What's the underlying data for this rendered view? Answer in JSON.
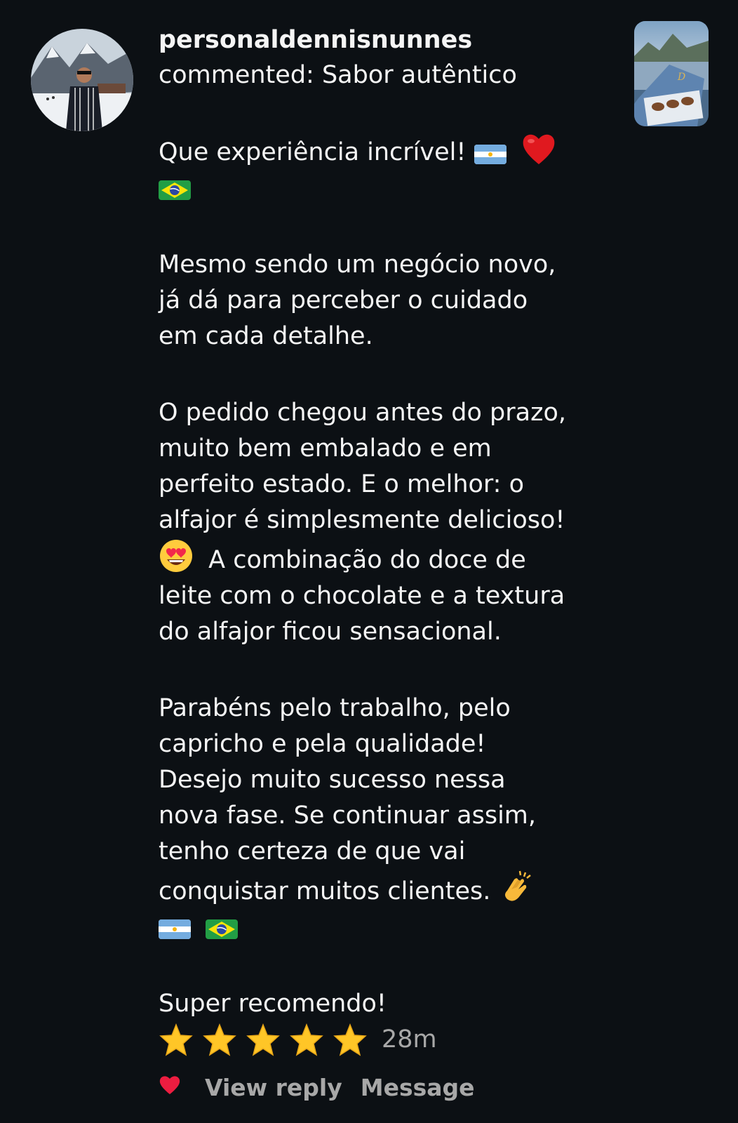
{
  "comment": {
    "username": "personaldennisnunnes",
    "subtitle": "commented: Sabor autêntico",
    "p1": {
      "line1": "Que experiência incrível!"
    },
    "p2": {
      "line1": "Mesmo sendo um negócio novo,",
      "line2": "já dá para perceber o cuidado",
      "line3": "em cada detalhe."
    },
    "p3": {
      "line1": "O pedido chegou antes do prazo,",
      "line2": "muito bem embalado e em",
      "line3": "perfeito estado. E o melhor: o",
      "line4": "alfajor é simplesmente delicioso!",
      "line5": "A combinação do doce de",
      "line6": "leite com o chocolate e a textura",
      "line7": "do alfajor ficou sensacional."
    },
    "p4": {
      "line1": "Parabéns pelo trabalho, pelo",
      "line2": "capricho e pela qualidade!",
      "line3": "Desejo muito sucesso nessa",
      "line4": "nova fase. Se continuar assim,",
      "line5": "tenho certeza de que vai",
      "line6": "conquistar muitos clientes."
    },
    "p5": {
      "line1": "Super recomendo!"
    },
    "rating_stars": 5,
    "time": "28m"
  },
  "actions": {
    "view_reply": "View reply",
    "message": "Message"
  },
  "icons": {
    "avatar": "profile-photo",
    "thumbnail": "post-thumbnail",
    "like": "heart-icon",
    "emojis": [
      "argentina-flag",
      "red-heart",
      "brazil-flag",
      "heart-eyes-face",
      "clapping-hands",
      "star"
    ]
  },
  "colors": {
    "background": "#0c1014",
    "text": "#f5f5f5",
    "secondary_text": "#a8a8a8",
    "like_heart": "#ed1d40"
  }
}
